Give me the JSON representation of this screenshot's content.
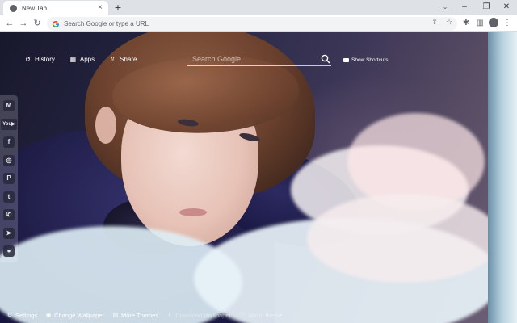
{
  "tab": {
    "title": "New Tab",
    "close_glyph": "×",
    "new_tab_glyph": "+"
  },
  "window_controls": {
    "tab_search_glyph": "⌄",
    "minimize_glyph": "–",
    "restore_glyph": "❐",
    "close_glyph": "✕"
  },
  "toolbar": {
    "back_glyph": "←",
    "forward_glyph": "→",
    "reload_glyph": "↻",
    "omnibox_placeholder": "Search Google or type a URL",
    "share_glyph": "⇪",
    "bookmark_glyph": "☆",
    "extensions_glyph": "✱",
    "sidepanel_glyph": "▥",
    "menu_glyph": "⋮"
  },
  "nav": {
    "history": "History",
    "apps": "Apps",
    "share": "Share",
    "history_glyph": "↺",
    "apps_glyph": "▦",
    "share_glyph": "⇪"
  },
  "search": {
    "placeholder": "Search Google"
  },
  "shortcuts": {
    "label": "Show Shortcuts"
  },
  "social": [
    {
      "name": "gmail-icon",
      "glyph": "M"
    },
    {
      "name": "youtube-icon",
      "glyph": "You▶"
    },
    {
      "name": "facebook-icon",
      "glyph": "f"
    },
    {
      "name": "instagram-icon",
      "glyph": "◎"
    },
    {
      "name": "pinterest-icon",
      "glyph": "P"
    },
    {
      "name": "twitter-icon",
      "glyph": "t"
    },
    {
      "name": "whatsapp-icon",
      "glyph": "✆"
    },
    {
      "name": "telegram-icon",
      "glyph": "➤"
    },
    {
      "name": "reddit-icon",
      "glyph": "●"
    }
  ],
  "bottom": {
    "settings": "Settings",
    "change_wallpaper": "Change Wallpaper",
    "more_themes": "More Themes",
    "download_wallpaper": "Download Wallpaper",
    "about": "About theme",
    "settings_glyph": "⚙",
    "change_glyph": "▣",
    "themes_glyph": "▤",
    "download_glyph": "⬇",
    "about_glyph": "ⓘ"
  },
  "colors": {
    "tabstrip": "#dee1e6",
    "toolbar": "#ffffff",
    "accent_text": "#ffffff"
  }
}
